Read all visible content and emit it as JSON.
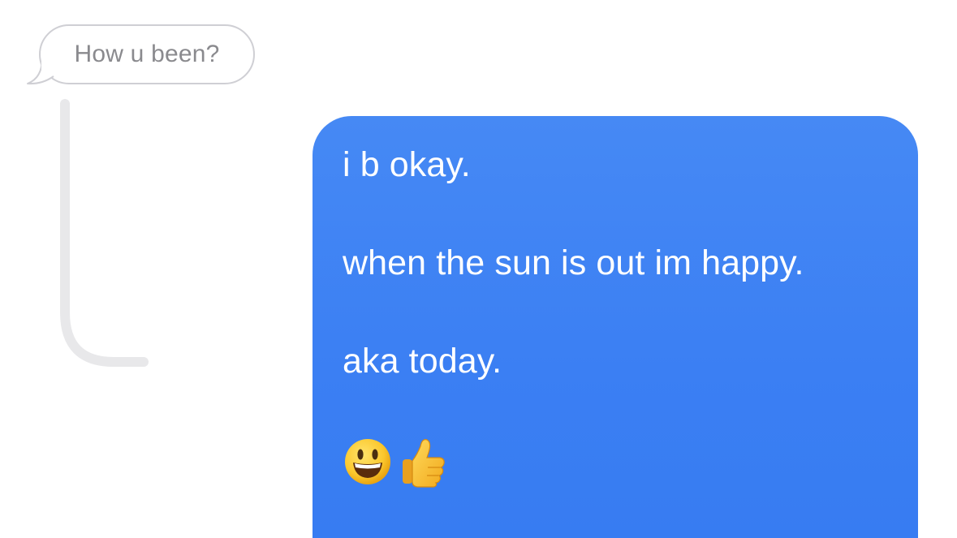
{
  "quoted_message": {
    "text": "How u been?"
  },
  "sent_message": {
    "lines": [
      "i b okay.",
      "when the sun is out im happy.",
      "aka today."
    ],
    "emojis": [
      "smiley-face-icon",
      "thumbs-up-icon"
    ]
  },
  "colors": {
    "sent_bubble": "#3b82f4",
    "quoted_border": "#cfcfd4",
    "quoted_text": "#8a8a8e",
    "thread_line": "#e8e8ea"
  }
}
